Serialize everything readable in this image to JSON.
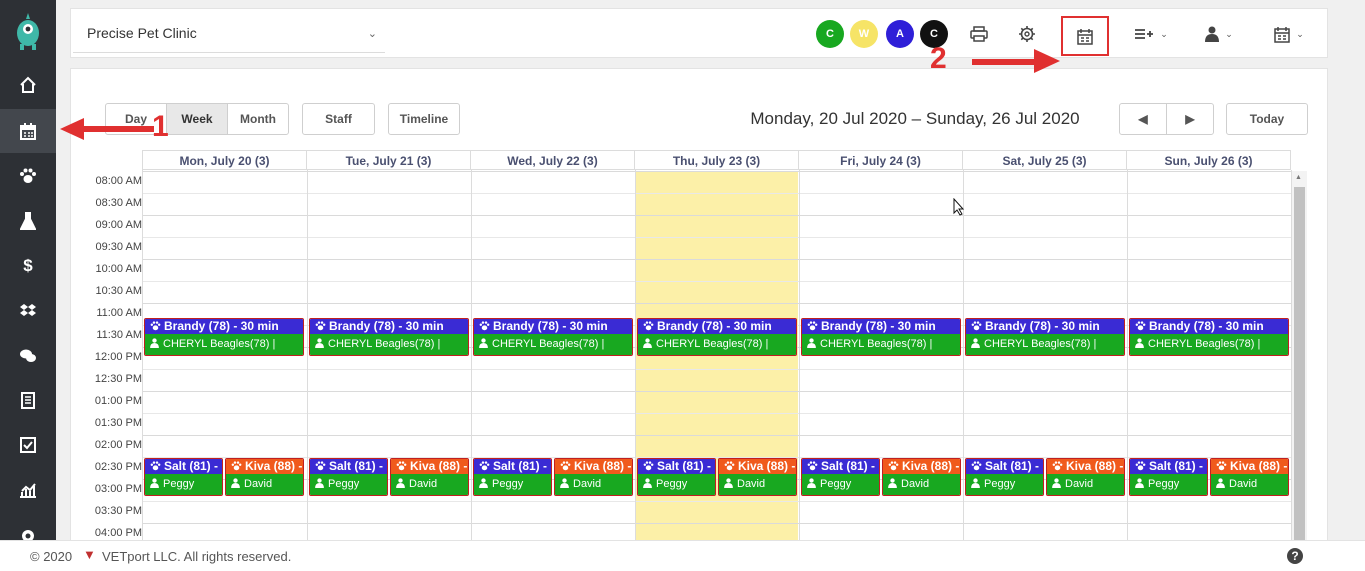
{
  "clinic": {
    "name": "Precise Pet Clinic"
  },
  "colors": {
    "green": "#18a820",
    "yellow": "#f8e76a",
    "blue": "#2f1fd8",
    "black": "#111111",
    "event_blue": "#3a2bd4",
    "event_orange": "#f05a1c",
    "event_green": "#18a820",
    "today": "#fcf0a8",
    "annotation": "#e03030"
  },
  "circles": [
    {
      "label": "C",
      "color": "#18a820"
    },
    {
      "label": "W",
      "color": "#f6e467"
    },
    {
      "label": "A",
      "color": "#2f1fd8"
    },
    {
      "label": "C",
      "color": "#111111"
    }
  ],
  "toolbar_icons": [
    "printer-icon",
    "gear-icon",
    "calendar-view-icon",
    "list-add-icon",
    "staff-icon",
    "calendar-icon"
  ],
  "sidebar_icons": [
    "home-icon",
    "calendar-icon",
    "paw-icon",
    "flask-icon",
    "dollar-icon",
    "dropbox-icon",
    "chat-icon",
    "ledger-icon",
    "checkbox-icon",
    "chart-icon",
    "settings-icon"
  ],
  "views": {
    "day": "Day",
    "week": "Week",
    "month": "Month",
    "staff": "Staff",
    "timeline": "Timeline",
    "today": "Today"
  },
  "date_range": "Monday, 20 Jul 2020 – Sunday, 26 Jul 2020",
  "days": [
    "Mon, July 20 (3)",
    "Tue, July 21 (3)",
    "Wed, July 22 (3)",
    "Thu, July 23 (3)",
    "Fri, July 24 (3)",
    "Sat, July 25 (3)",
    "Sun, July 26 (3)"
  ],
  "times": [
    "08:00 AM",
    "08:30 AM",
    "09:00 AM",
    "09:30 AM",
    "10:00 AM",
    "10:30 AM",
    "11:00 AM",
    "11:30 AM",
    "12:00 PM",
    "12:30 PM",
    "01:00 PM",
    "01:30 PM",
    "02:00 PM",
    "02:30 PM",
    "03:00 PM",
    "03:30 PM",
    "04:00 PM"
  ],
  "events": {
    "e1": {
      "title": "Brandy (78) - 30 min",
      "owner": "CHERYL Beagles(78) |"
    },
    "e2": {
      "title": "Salt (81) -",
      "owner": "Peggy"
    },
    "e3": {
      "title": "Kiva (88) -",
      "owner": "David"
    }
  },
  "annotations": {
    "a1": "1",
    "a2": "2"
  },
  "footer": {
    "copyright": "© 2020",
    "company": "VETport LLC. All rights reserved.",
    "help": "?"
  }
}
